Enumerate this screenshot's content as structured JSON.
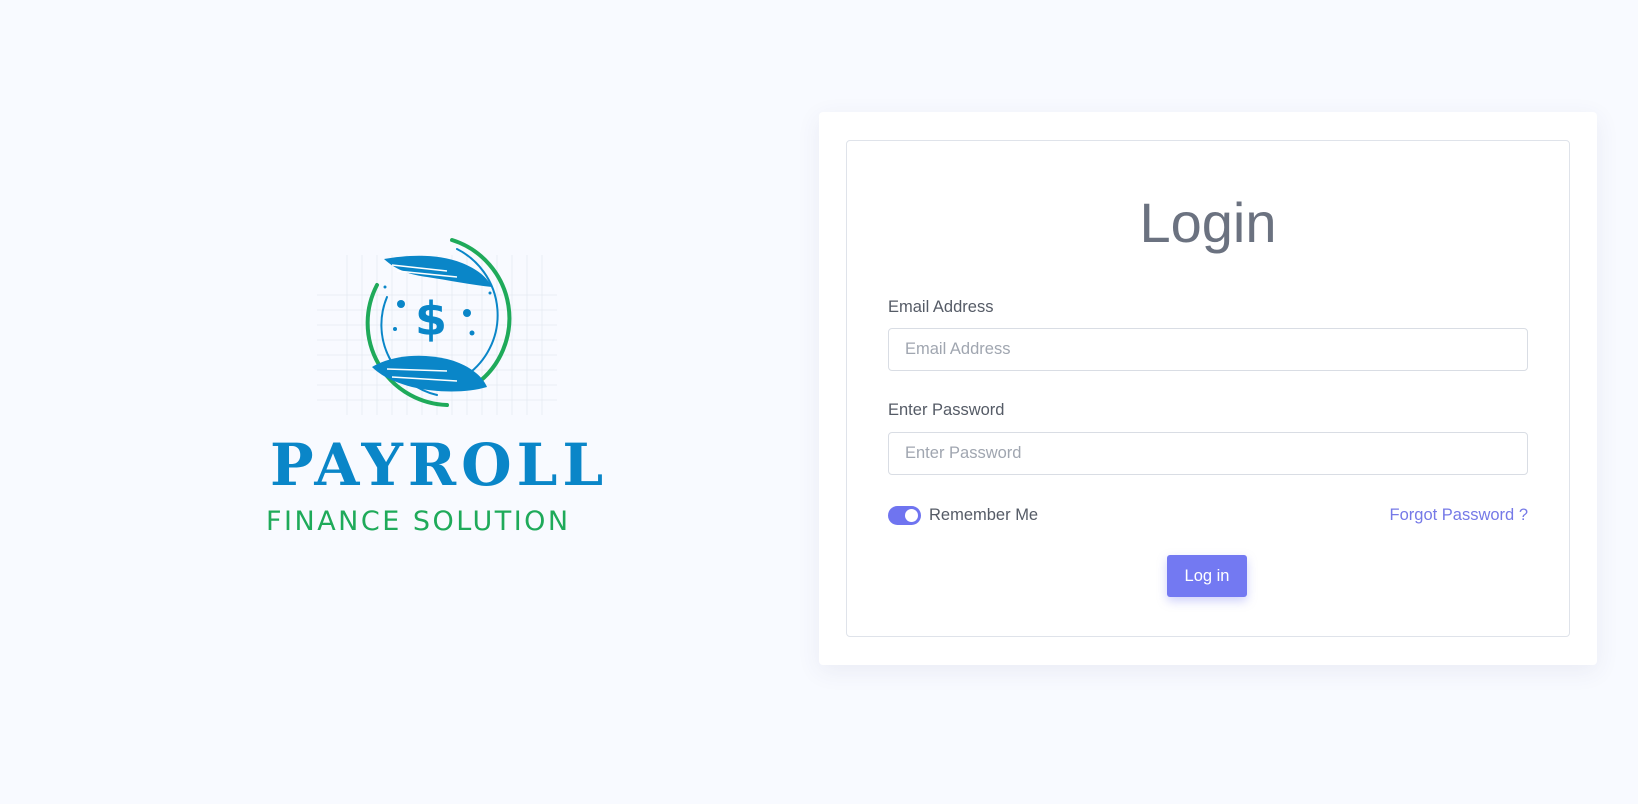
{
  "logo": {
    "title": "PAYROLL",
    "subtitle": "FINANCE SOLUTION",
    "emblem_icon": "hands-holding-dollar-icon",
    "colors": {
      "blue": "#0a86c8",
      "green": "#1faa5a"
    }
  },
  "login": {
    "title": "Login",
    "email": {
      "label": "Email Address",
      "placeholder": "Email Address",
      "value": ""
    },
    "password": {
      "label": "Enter Password",
      "placeholder": "Enter Password",
      "value": ""
    },
    "remember": {
      "label": "Remember Me",
      "checked": true
    },
    "forgot_label": "Forgot Password ?",
    "submit_label": "Log in"
  },
  "colors": {
    "background": "#f8faff",
    "accent": "#7379f2",
    "text": "#555b66"
  }
}
